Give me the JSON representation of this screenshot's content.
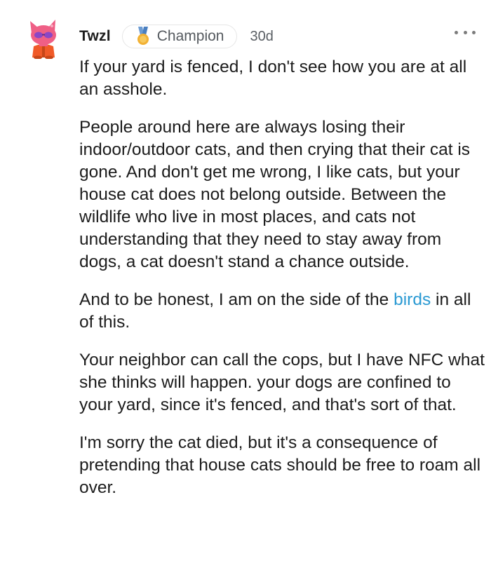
{
  "comment": {
    "username": "Twzl",
    "badge": {
      "label": "Champion",
      "icon": "medal-icon",
      "icon_color": "#f2b134"
    },
    "timestamp": "30d",
    "more_icon": "ellipsis-icon",
    "avatar": {
      "description_icon": "snoo-cat-avatar",
      "colors": {
        "primary": "#ef5f86",
        "shirt": "#f05a28",
        "glasses": "#8a47c6"
      }
    },
    "paragraphs": [
      {
        "text": "If your yard is fenced, I don't see how you are at all an asshole."
      },
      {
        "text": "People around here are always losing their indoor/outdoor cats, and then crying that their cat is gone. And don't get me wrong, I like cats, but your house cat does not belong outside. Between the wildlife who live in most places, and cats not understanding that they need to stay away from dogs, a cat doesn't stand a chance outside."
      },
      {
        "text_before": "And to be honest, I am on the side of the ",
        "link": "birds",
        "text_after": " in all of this."
      },
      {
        "text": "Your neighbor can call the cops, but I have NFC what she thinks will happen. your dogs are confined to your yard, since it's fenced, and that's sort of that."
      },
      {
        "text": "I'm sorry the cat died, but it's a consequence of pretending that house cats should be free to roam all over."
      }
    ],
    "link_color": "#2b9ad3"
  }
}
